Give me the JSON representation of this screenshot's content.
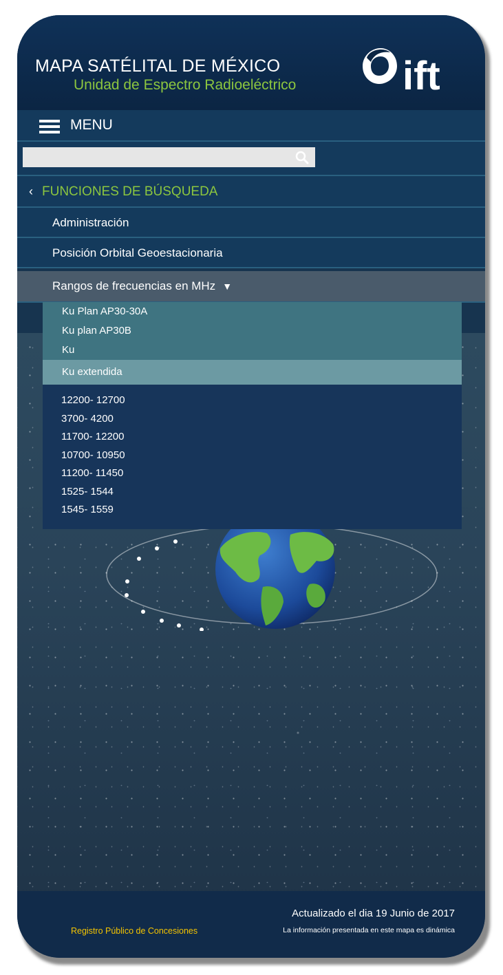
{
  "header": {
    "title": "MAPA SATÉLITAL DE MÉXICO",
    "subtitle": "Unidad de Espectro Radioeléctrico",
    "logo_text": "ift"
  },
  "menu": {
    "label": "MENU",
    "icon": "hamburger-icon"
  },
  "search": {
    "value": "",
    "placeholder": "",
    "icon": "search-icon"
  },
  "nav": {
    "back_label": "FUNCIONES DE BÚSQUEDA",
    "back_icon": "chevron-left-icon",
    "items": [
      {
        "label": "Administración"
      },
      {
        "label": "Posición Orbital Geoestacionaria"
      },
      {
        "label": "Rangos de frecuencias en MHz",
        "expanded": true,
        "icon": "caret-down-icon"
      }
    ]
  },
  "dropdown": {
    "bands": [
      {
        "label": "Ku Plan AP30-30A"
      },
      {
        "label": "Ku plan AP30B"
      },
      {
        "label": "Ku"
      },
      {
        "label": "Ku extendida",
        "selected": true
      }
    ],
    "ranges": [
      "12200- 12700",
      "3700- 4200",
      "11700- 12200",
      "10700- 10950",
      "11200- 11450",
      "1525- 1544",
      "1545- 1559"
    ]
  },
  "footer": {
    "link": "Registro Público de Concesiones",
    "updated": "Actualizado  el dia 19  Junio de 2017",
    "note": "La información presentada en este mapa es dinámica"
  },
  "colors": {
    "accent_green": "#8cc63f",
    "link_yellow": "#f5c400",
    "nav_bg": "#143a5c"
  }
}
